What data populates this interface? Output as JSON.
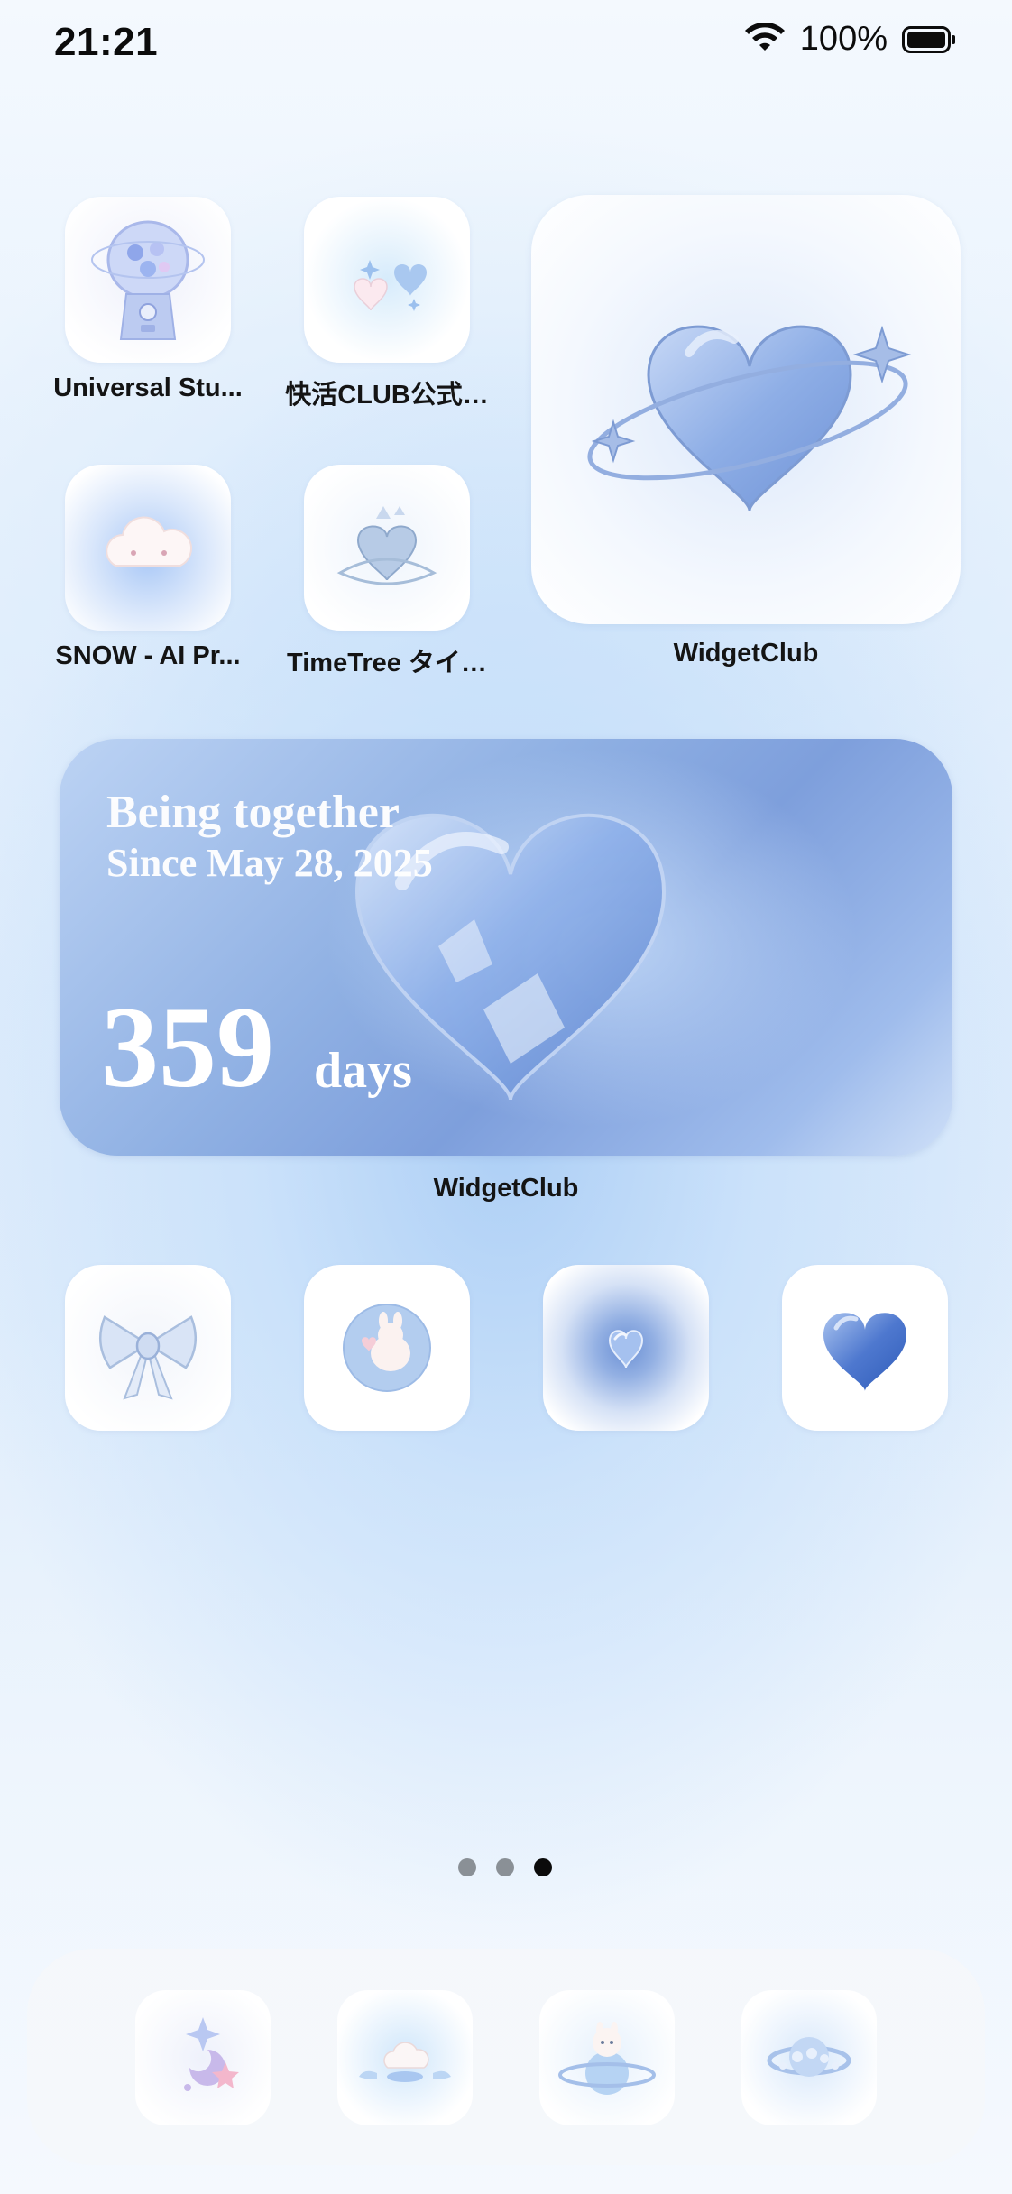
{
  "status_bar": {
    "time": "21:21",
    "battery_percent": "100%",
    "icons": [
      "wifi-icon",
      "battery-icon"
    ]
  },
  "apps": [
    {
      "label": "Universal Stu...",
      "icon": "gumball-machine-icon"
    },
    {
      "label": "快活CLUB公式…",
      "icon": "hearts-sparkle-icon"
    },
    {
      "label": "SNOW - AI Pr...",
      "icon": "cloud-icon"
    },
    {
      "label": "TimeTree タイ…",
      "icon": "crystal-heart-icon"
    }
  ],
  "widget_square": {
    "label": "WidgetClub",
    "icon": "orbit-heart-icon"
  },
  "widget_wide": {
    "title": "Being together",
    "since": "Since May 28, 2025",
    "count": "359",
    "unit": "days",
    "label": "WidgetClub",
    "icon": "glass-heart-icon"
  },
  "row_icons": [
    {
      "icon": "bow-icon"
    },
    {
      "icon": "moon-bunny-icon"
    },
    {
      "icon": "glowing-heart-icon"
    },
    {
      "icon": "blue-heart-icon"
    }
  ],
  "page_indicator": {
    "count": 3,
    "active": 3
  },
  "dock": [
    {
      "icon": "moon-stars-icon"
    },
    {
      "icon": "cloud-wings-icon"
    },
    {
      "icon": "planet-bunny-icon"
    },
    {
      "icon": "saturn-icon"
    }
  ],
  "colors": {
    "accent_blue": "#7e9fdc",
    "text_dark": "#141414",
    "page_dot_inactive": "#8a9096",
    "page_dot_active": "#0b0b0b"
  }
}
